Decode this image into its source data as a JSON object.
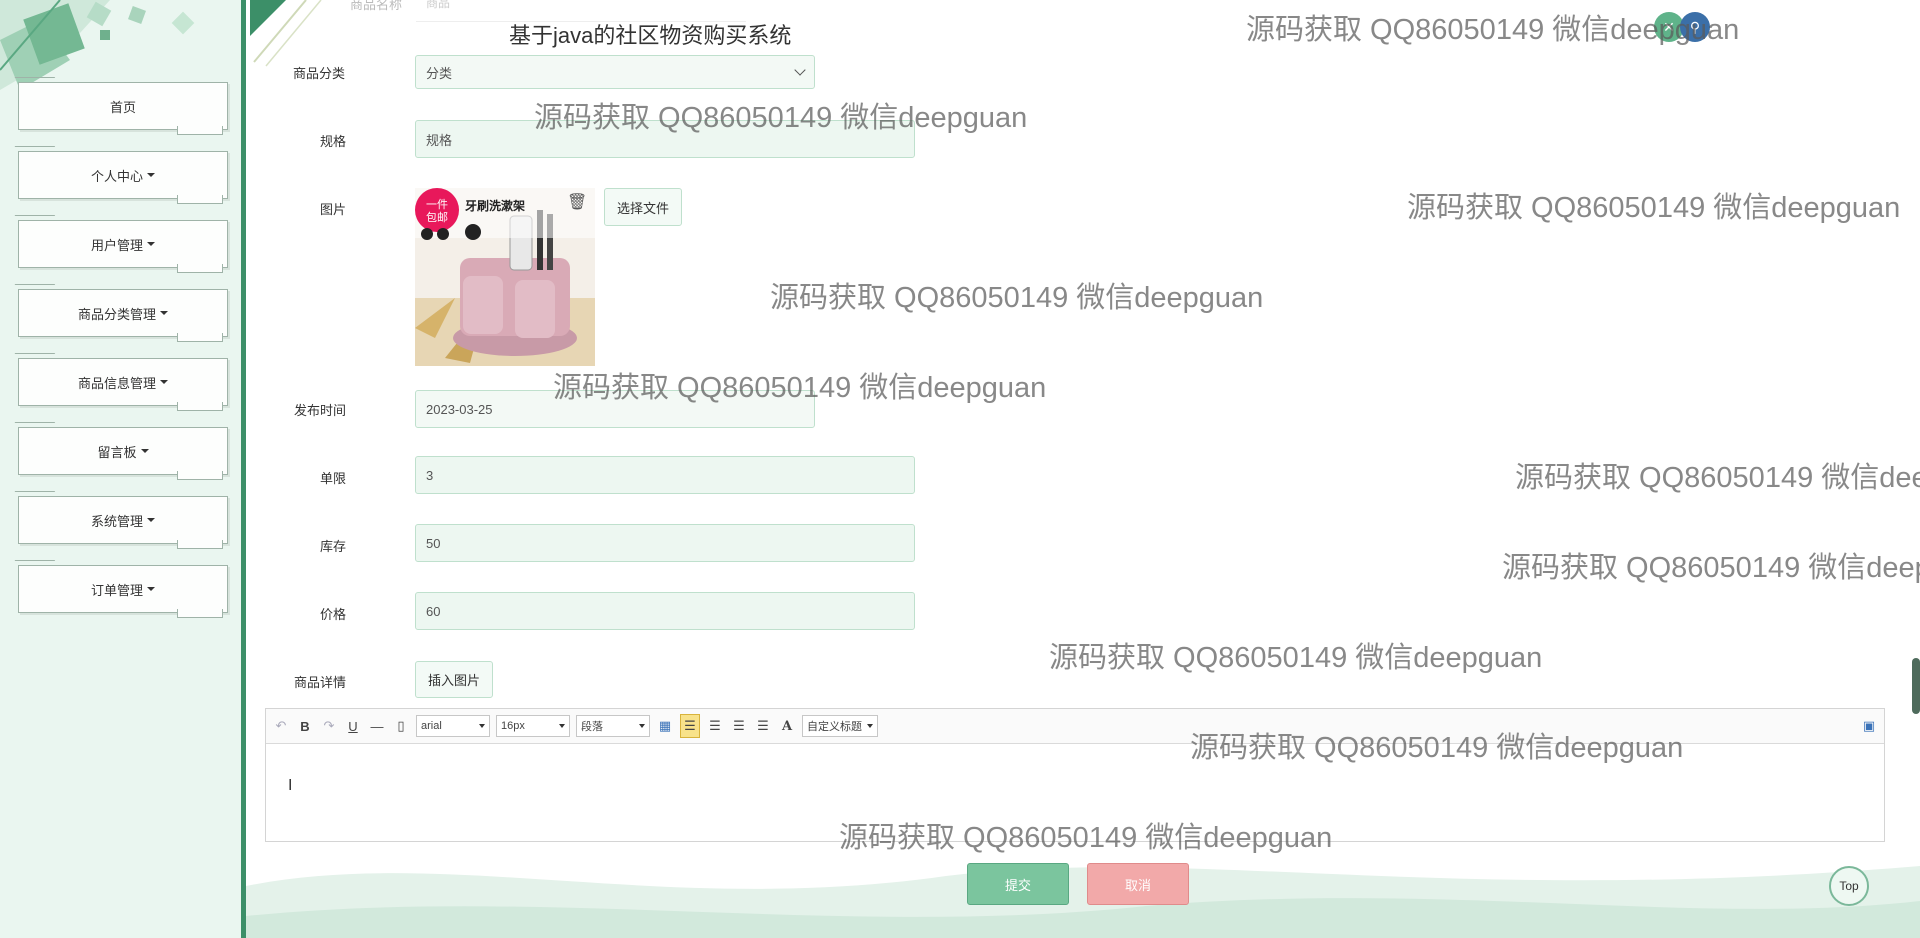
{
  "sidebar": {
    "items": [
      {
        "label": "首页",
        "dropdown": false
      },
      {
        "label": "个人中心",
        "dropdown": true
      },
      {
        "label": "用户管理",
        "dropdown": true
      },
      {
        "label": "商品分类管理",
        "dropdown": true
      },
      {
        "label": "商品信息管理",
        "dropdown": true
      },
      {
        "label": "留言板",
        "dropdown": true
      },
      {
        "label": "系统管理",
        "dropdown": true
      },
      {
        "label": "订单管理",
        "dropdown": true
      }
    ]
  },
  "header": {
    "title": "基于java的社区物资购买系统",
    "icons": [
      "close-icon",
      "user-icon"
    ]
  },
  "form": {
    "faded_label": "商品名称",
    "faded_value": "商品",
    "category": {
      "label": "商品分类",
      "value": "分类"
    },
    "spec": {
      "label": "规格",
      "value": "规格"
    },
    "image": {
      "label": "图片",
      "choose_label": "选择文件",
      "ad_text": "一件包邮",
      "product_text": "牙刷洗漱架"
    },
    "publish_time": {
      "label": "发布时间",
      "value": "2023-03-25"
    },
    "limit": {
      "label": "单限",
      "value": "3"
    },
    "stock": {
      "label": "库存",
      "value": "50"
    },
    "price": {
      "label": "价格",
      "value": "60"
    },
    "detail": {
      "label": "商品详情",
      "insert_label": "插入图片"
    }
  },
  "editor": {
    "font_family": "arial",
    "font_size": "16px",
    "paragraph": "段落",
    "custom_title": "自定义标题",
    "content": ""
  },
  "actions": {
    "submit": "提交",
    "cancel": "取消",
    "top": "Top"
  },
  "watermark": "源码获取 QQ86050149 微信deepguan",
  "colors": {
    "accent": "#3c8f68",
    "input_bg": "#edf7f1",
    "submit": "#7bc59e",
    "cancel": "#f2a9a9"
  }
}
